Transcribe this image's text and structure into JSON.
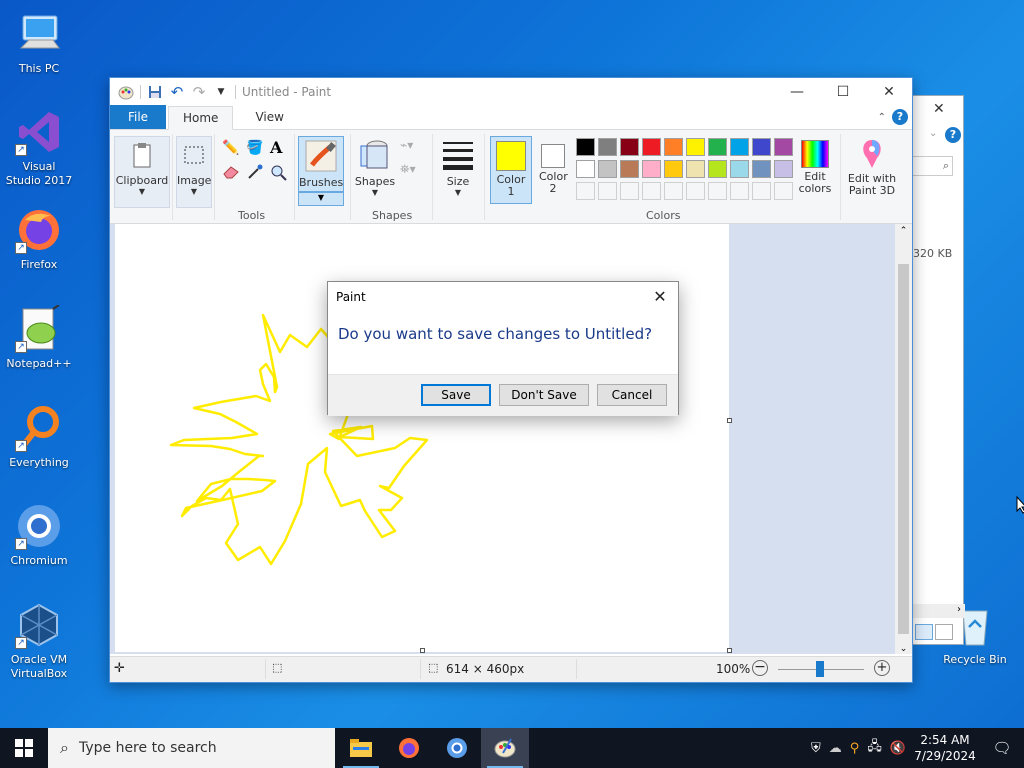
{
  "desktop": {
    "icons": [
      {
        "label": "This PC"
      },
      {
        "label": "Visual Studio 2017"
      },
      {
        "label": "Firefox"
      },
      {
        "label": "Notepad++"
      },
      {
        "label": "Everything"
      },
      {
        "label": "Chromium"
      },
      {
        "label": "Oracle VM VirtualBox"
      },
      {
        "label": "Recycle Bin"
      }
    ]
  },
  "bg_window": {
    "size_text": "320 KB"
  },
  "paint": {
    "title": "Untitled - Paint",
    "tabs": {
      "file": "File",
      "home": "Home",
      "view": "View"
    },
    "ribbon": {
      "clipboard": "Clipboard",
      "image": "Image",
      "tools": "Tools",
      "brushes": "Brushes",
      "shapes_btn": "Shapes",
      "shapes_group": "Shapes",
      "size": "Size",
      "color1": "Color 1",
      "color2": "Color 2",
      "colors_group": "Colors",
      "edit_colors": "Edit colors",
      "edit_paint3d": "Edit with Paint 3D"
    },
    "palette_row1": [
      "#000000",
      "#7f7f7f",
      "#880015",
      "#ed1c24",
      "#ff7f27",
      "#fff200",
      "#22b14c",
      "#00a2e8",
      "#3f48cc",
      "#a349a4"
    ],
    "palette_row2": [
      "#ffffff",
      "#c3c3c3",
      "#b97a57",
      "#ffaec9",
      "#ffc90e",
      "#efe4b0",
      "#b5e61d",
      "#99d9ea",
      "#7092be",
      "#c8bfe7"
    ],
    "color1_value": "#ffff00",
    "color2_value": "#ffffff",
    "status": {
      "dimensions": "614 × 460px",
      "zoom": "100%"
    }
  },
  "dialog": {
    "title": "Paint",
    "message": "Do you want to save changes to Untitled?",
    "save": "Save",
    "dont_save": "Don't Save",
    "cancel": "Cancel"
  },
  "taskbar": {
    "search_placeholder": "Type here to search",
    "time": "2:54 AM",
    "date": "7/29/2024"
  }
}
